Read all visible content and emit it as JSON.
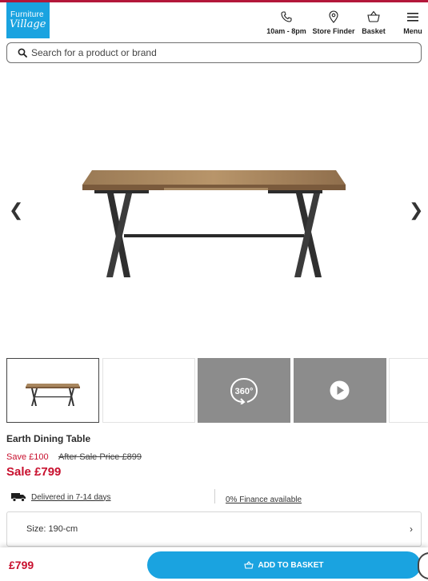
{
  "header": {
    "logo_line1": "Furniture",
    "logo_line2": "Village",
    "nav": [
      {
        "label": "10am - 8pm",
        "icon": "phone-icon"
      },
      {
        "label": "Store Finder",
        "icon": "location-pin-icon"
      },
      {
        "label": "Basket",
        "icon": "basket-icon"
      },
      {
        "label": "Menu",
        "icon": "hamburger-menu-icon"
      }
    ]
  },
  "search": {
    "placeholder": "Search for a product or brand"
  },
  "gallery": {
    "prev_glyph": "❮",
    "next_glyph": "❯",
    "thumbnails": [
      {
        "type": "image",
        "selected": true
      },
      {
        "type": "image",
        "selected": false
      },
      {
        "type": "360",
        "label": "360°"
      },
      {
        "type": "video"
      },
      {
        "type": "image",
        "selected": false
      }
    ]
  },
  "product": {
    "title": "Earth Dining Table",
    "save": "Save £100",
    "was": "After Sale Price £899",
    "sale": "Sale £799",
    "delivery": "Delivered in 7-14 days",
    "finance": "0% Finance available",
    "size": "Size: 190-cm"
  },
  "bottom_bar": {
    "price": "£799",
    "add_label": "ADD TO BASKET"
  },
  "colors": {
    "brand_blue": "#1aa3e0",
    "sale_red": "#c8102e",
    "top_line": "#b3173a"
  }
}
